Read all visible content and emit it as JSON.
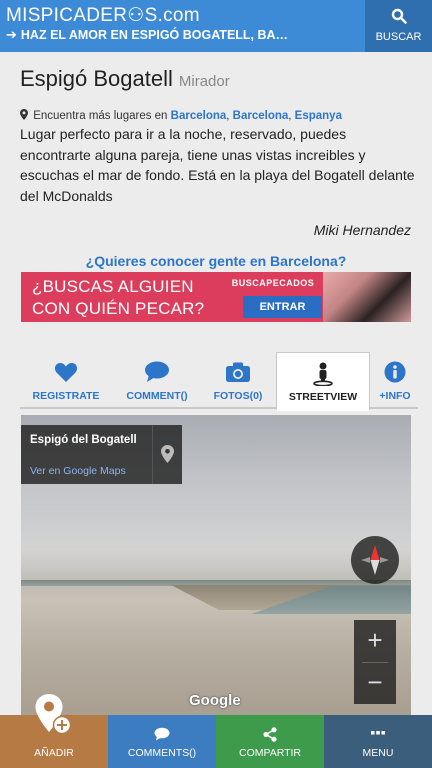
{
  "header": {
    "logo": "MISPICADER⚇S.com",
    "breadcrumb_prefix": "HAZ EL AMOR EN ",
    "breadcrumb_place": "ESPIGÓ BOGATELL, BA…",
    "search_label": "BUSCAR"
  },
  "place": {
    "title": "Espigó Bogatell",
    "category": "Mirador",
    "location_prefix": "Encuentra más lugares en",
    "locations": [
      "Barcelona",
      "Barcelona",
      "Espanya"
    ],
    "description": "Lugar perfecto para ir a la noche, reservado, puedes encontrarte alguna pareja, tiene unas vistas increibles y escuchas el mar de fondo. Está en la playa del Bogatell delante del McDonalds",
    "author": "Miki Hernandez"
  },
  "promo": {
    "question": "¿Quieres conocer gente en Barcelona?",
    "banner_line1": "¿BUSCAS ALGUIEN",
    "banner_line2": "CON QUIÉN PECAR?",
    "banner_brand": "BUSCAPECADOS",
    "banner_button": "ENTRAR"
  },
  "tabs": [
    {
      "label": "REGISTRATE",
      "icon": "heart-icon"
    },
    {
      "label": "COMMENT()",
      "icon": "comment-icon"
    },
    {
      "label": "FOTOS(0)",
      "icon": "camera-icon"
    },
    {
      "label": "STREETVIEW",
      "icon": "pegman-icon",
      "active": true
    },
    {
      "label": "+INFO",
      "icon": "info-icon"
    }
  ],
  "streetview": {
    "place_name": "Espigó del Bogatell",
    "maps_link": "Ver en Google Maps",
    "zoom_in": "+",
    "zoom_out": "−",
    "watermark": "Google"
  },
  "bottom_bar": [
    {
      "label": "AÑADIR",
      "icon": "add-location-icon",
      "color": "#b67a45"
    },
    {
      "label": "COMMENTS()",
      "icon": "comment-icon",
      "color": "#3c7cc0"
    },
    {
      "label": "COMPARTIR",
      "icon": "share-icon",
      "color": "#3d9b4b"
    },
    {
      "label": "MENU",
      "icon": "menu-dots-icon",
      "color": "#3b5e7c"
    }
  ],
  "colors": {
    "header": "#3d8ad6",
    "link": "#2c75c8",
    "banner": "#dd3d5c"
  }
}
